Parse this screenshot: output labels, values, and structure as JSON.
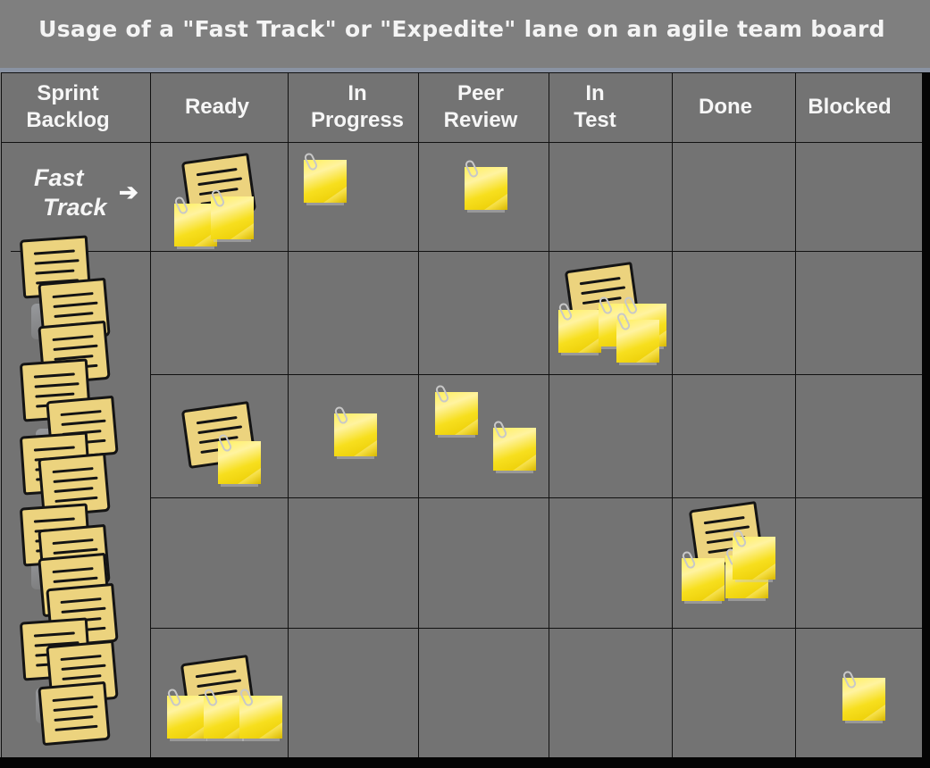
{
  "title": "Usage of a \"Fast Track\" or \"Expedite\" lane on an agile team board",
  "columns": [
    {
      "label": "Sprint\nBacklog"
    },
    {
      "label": "Ready"
    },
    {
      "label": "In\nProgress"
    },
    {
      "label": "Peer\nReview"
    },
    {
      "label": "In\nTest"
    },
    {
      "label": "Done"
    },
    {
      "label": "Blocked"
    }
  ],
  "fast_track": {
    "line1": "Fast",
    "line2": "Track",
    "arrow_icon": "➔"
  },
  "colors": {
    "background": "#7f7f7f",
    "board": "#737373",
    "grid_line": "#111111",
    "backlog_card": "#ecd37e",
    "sticky_note": "#f7df1e",
    "text": "#f6f6f6"
  },
  "lanes": [
    {
      "name": "fast-track",
      "tasks": {
        "Ready": 2,
        "In Progress": 1,
        "Peer Review": 1,
        "In Test": 0,
        "Done": 0,
        "Blocked": 0
      },
      "stories_in_ready": 1
    },
    {
      "name": "row-1",
      "tasks": {
        "Ready": 0,
        "In Progress": 0,
        "Peer Review": 0,
        "In Test": 4,
        "Done": 0,
        "Blocked": 0
      },
      "stories_in_test": 1
    },
    {
      "name": "row-2",
      "tasks": {
        "Ready": 1,
        "In Progress": 1,
        "Peer Review": 2,
        "In Test": 0,
        "Done": 0,
        "Blocked": 0
      },
      "stories_in_ready": 1
    },
    {
      "name": "row-3",
      "tasks": {
        "Ready": 0,
        "In Progress": 0,
        "Peer Review": 0,
        "In Test": 0,
        "Done": 3,
        "Blocked": 0
      },
      "stories_in_done": 1
    },
    {
      "name": "row-4",
      "tasks": {
        "Ready": 3,
        "In Progress": 0,
        "Peer Review": 0,
        "In Test": 0,
        "Done": 0,
        "Blocked": 1
      },
      "stories_in_ready": 1
    }
  ],
  "sprint_backlog_story_count": 13
}
